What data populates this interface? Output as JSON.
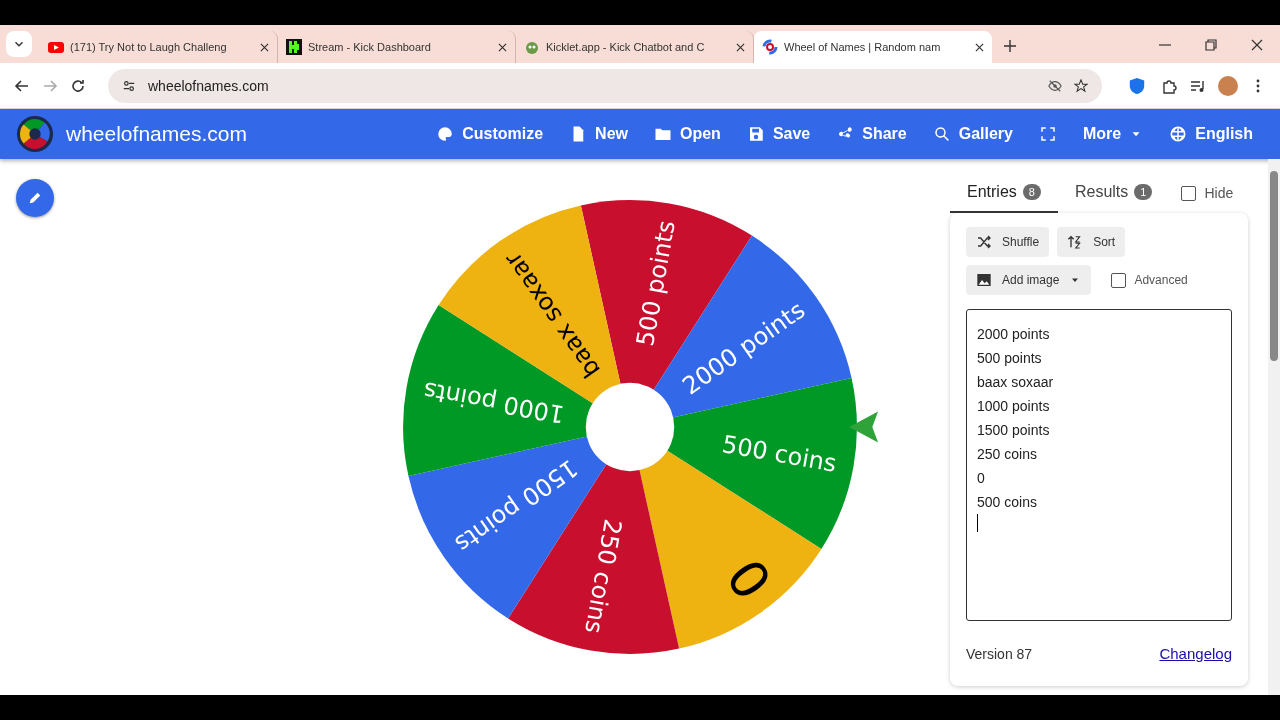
{
  "browser": {
    "tabs": [
      {
        "title": "(171) Try Not to Laugh Challeng",
        "selected": false
      },
      {
        "title": "Stream - Kick Dashboard",
        "selected": false
      },
      {
        "title": "Kicklet.app - Kick Chatbot and C",
        "selected": false
      },
      {
        "title": "Wheel of Names | Random nam",
        "selected": true
      }
    ],
    "address": "wheelofnames.com"
  },
  "header": {
    "brand": "wheelofnames.com",
    "nav": [
      {
        "label": "Customize"
      },
      {
        "label": "New"
      },
      {
        "label": "Open"
      },
      {
        "label": "Save"
      },
      {
        "label": "Share"
      },
      {
        "label": "Gallery"
      },
      {
        "label": "More"
      },
      {
        "label": "English"
      }
    ]
  },
  "wheel": {
    "segments": [
      {
        "label": "500 points",
        "color": "#c8102e"
      },
      {
        "label": "2000 points",
        "color": "#3369e8"
      },
      {
        "label": "500 coins",
        "color": "#009925"
      },
      {
        "label": "0",
        "color": "#eeb211"
      },
      {
        "label": "250 coins",
        "color": "#c8102e"
      },
      {
        "label": "1500 points",
        "color": "#3369e8"
      },
      {
        "label": "1000 points",
        "color": "#009925"
      },
      {
        "label": "baax soxaar",
        "color": "#eeb211"
      }
    ]
  },
  "panel": {
    "tabs": [
      {
        "label": "Entries",
        "count": "8",
        "selected": true
      },
      {
        "label": "Results",
        "count": "1",
        "selected": false
      }
    ],
    "hide": {
      "label": "Hide",
      "checked": false
    },
    "buttons": [
      {
        "label": "Shuffle"
      },
      {
        "label": "Sort"
      }
    ],
    "add_image": "Add image",
    "advanced": {
      "label": "Advanced",
      "checked": false
    },
    "entries": [
      "2000 points",
      "500 points",
      "baax soxaar",
      "1000 points",
      "1500 points",
      "250 coins",
      "0",
      "500 coins"
    ],
    "version": "Version 87",
    "changelog": "Changelog"
  }
}
